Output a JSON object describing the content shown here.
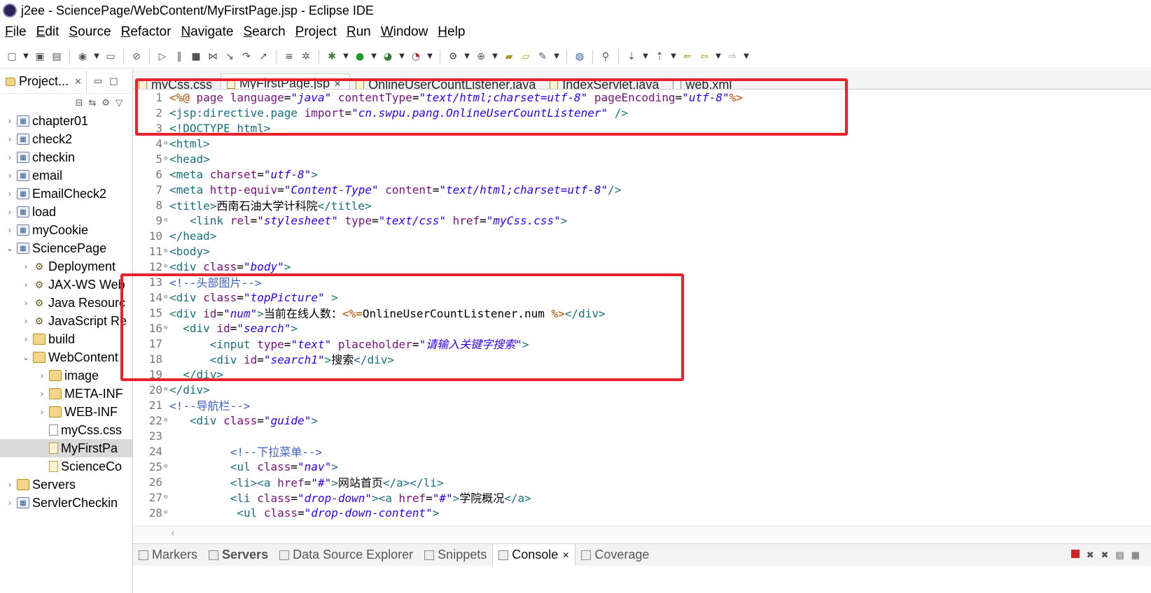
{
  "window": {
    "title": "j2ee - SciencePage/WebContent/MyFirstPage.jsp - Eclipse IDE"
  },
  "menu": [
    "File",
    "Edit",
    "Source",
    "Refactor",
    "Navigate",
    "Search",
    "Project",
    "Run",
    "Window",
    "Help"
  ],
  "project_explorer": {
    "tab_label": "Project...",
    "tree": [
      {
        "label": "chapter01",
        "icon": "project-icon",
        "depth": 0,
        "expanded": false
      },
      {
        "label": "check2",
        "icon": "project-icon",
        "depth": 0,
        "expanded": false
      },
      {
        "label": "checkin",
        "icon": "project-icon",
        "depth": 0,
        "expanded": false
      },
      {
        "label": "email",
        "icon": "project-icon",
        "depth": 0,
        "expanded": false
      },
      {
        "label": "EmailCheck2",
        "icon": "project-icon",
        "depth": 0,
        "expanded": false
      },
      {
        "label": "load",
        "icon": "project-icon",
        "depth": 0,
        "expanded": false
      },
      {
        "label": "myCookie",
        "icon": "project-icon",
        "depth": 0,
        "expanded": false
      },
      {
        "label": "SciencePage",
        "icon": "project-icon",
        "depth": 0,
        "expanded": true
      },
      {
        "label": "Deployment",
        "icon": "deployment-icon",
        "depth": 1,
        "expanded": false
      },
      {
        "label": "JAX-WS Web",
        "icon": "jaxws-icon",
        "depth": 1,
        "expanded": false
      },
      {
        "label": "Java Resourc",
        "icon": "java-resources-icon",
        "depth": 1,
        "expanded": false
      },
      {
        "label": "JavaScript Re",
        "icon": "javascript-resources-icon",
        "depth": 1,
        "expanded": false
      },
      {
        "label": "build",
        "icon": "folder-icon",
        "depth": 1,
        "expanded": false
      },
      {
        "label": "WebContent",
        "icon": "folder-icon",
        "depth": 1,
        "expanded": true
      },
      {
        "label": "image",
        "icon": "folder-icon",
        "depth": 2,
        "expanded": false
      },
      {
        "label": "META-INF",
        "icon": "folder-icon",
        "depth": 2,
        "expanded": false
      },
      {
        "label": "WEB-INF",
        "icon": "folder-icon",
        "depth": 2,
        "expanded": false
      },
      {
        "label": "myCss.css",
        "icon": "file-icon",
        "depth": 2,
        "expanded": null
      },
      {
        "label": "MyFirstPa",
        "icon": "jsp-file-icon",
        "depth": 2,
        "expanded": null,
        "selected": true
      },
      {
        "label": "ScienceCo",
        "icon": "jsp-file-icon",
        "depth": 2,
        "expanded": null
      },
      {
        "label": "Servers",
        "icon": "folder-icon",
        "depth": 0,
        "expanded": false
      },
      {
        "label": "ServlerCheckin",
        "icon": "project-icon",
        "depth": 0,
        "expanded": false
      }
    ]
  },
  "editor_tabs": [
    {
      "label": "myCss.css",
      "active": false,
      "icon": "css-file-icon"
    },
    {
      "label": "MyFirstPage.jsp",
      "active": true,
      "icon": "jsp-file-icon"
    },
    {
      "label": "OnlineUserCountListener.java",
      "active": false,
      "icon": "java-file-icon"
    },
    {
      "label": "IndexServlet.java",
      "active": false,
      "icon": "java-file-icon"
    },
    {
      "label": "web.xml",
      "active": false,
      "icon": "xml-file-icon"
    }
  ],
  "code": [
    {
      "n": "1",
      "fold": "",
      "t": [
        [
          "dir",
          "<%@ "
        ],
        [
          "attr",
          "page "
        ],
        [
          "attr",
          "language"
        ],
        [
          "txt",
          "="
        ],
        [
          "val",
          "\"java\""
        ],
        [
          "txt",
          " "
        ],
        [
          "attr",
          "contentType"
        ],
        [
          "txt",
          "="
        ],
        [
          "val",
          "\"text/html;charset=utf-8\""
        ],
        [
          "txt",
          " "
        ],
        [
          "attr",
          "pageEncoding"
        ],
        [
          "txt",
          "="
        ],
        [
          "val",
          "\"utf-8\""
        ],
        [
          "dir",
          "%>"
        ]
      ]
    },
    {
      "n": "2",
      "fold": "",
      "t": [
        [
          "tag",
          "<jsp:directive.page "
        ],
        [
          "attr",
          "import"
        ],
        [
          "txt",
          "="
        ],
        [
          "val",
          "\"cn.swpu.pang.OnlineUserCountListener\""
        ],
        [
          "tag",
          " />"
        ]
      ]
    },
    {
      "n": "3",
      "fold": "",
      "t": [
        [
          "tag",
          "<!DOCTYPE html>"
        ]
      ]
    },
    {
      "n": "4",
      "fold": "⊖",
      "t": [
        [
          "tag",
          "<html>"
        ]
      ]
    },
    {
      "n": "5",
      "fold": "⊖",
      "t": [
        [
          "tag",
          "<head>"
        ]
      ]
    },
    {
      "n": "6",
      "fold": "",
      "t": [
        [
          "tag",
          "<meta "
        ],
        [
          "attr",
          "charset"
        ],
        [
          "txt",
          "="
        ],
        [
          "val",
          "\"utf-8\""
        ],
        [
          "tag",
          ">"
        ]
      ]
    },
    {
      "n": "7",
      "fold": "",
      "t": [
        [
          "tag",
          "<meta "
        ],
        [
          "attr",
          "http-equiv"
        ],
        [
          "txt",
          "="
        ],
        [
          "val",
          "\"Content-Type\""
        ],
        [
          "txt",
          " "
        ],
        [
          "attr",
          "content"
        ],
        [
          "txt",
          "="
        ],
        [
          "val",
          "\"text/html;charset=utf-8\""
        ],
        [
          "tag",
          "/>"
        ]
      ]
    },
    {
      "n": "8",
      "fold": "",
      "t": [
        [
          "tag",
          "<title>"
        ],
        [
          "txt",
          "西南石油大学计科院"
        ],
        [
          "tag",
          "</title>"
        ]
      ]
    },
    {
      "n": "9",
      "fold": "⊖",
      "t": [
        [
          "txt",
          "   "
        ],
        [
          "tag",
          "<link "
        ],
        [
          "attr",
          "rel"
        ],
        [
          "txt",
          "="
        ],
        [
          "val",
          "\"stylesheet\""
        ],
        [
          "txt",
          " "
        ],
        [
          "attr",
          "type"
        ],
        [
          "txt",
          "="
        ],
        [
          "val",
          "\"text/css\""
        ],
        [
          "txt",
          " "
        ],
        [
          "attr",
          "href"
        ],
        [
          "txt",
          "="
        ],
        [
          "val",
          "\"myCss.css\""
        ],
        [
          "tag",
          ">"
        ]
      ]
    },
    {
      "n": "10",
      "fold": "",
      "t": [
        [
          "tag",
          "</head>"
        ]
      ]
    },
    {
      "n": "11",
      "fold": "⊖",
      "t": [
        [
          "tag",
          "<body>"
        ]
      ]
    },
    {
      "n": "12",
      "fold": "⊖",
      "t": [
        [
          "tag",
          "<div "
        ],
        [
          "attr",
          "class"
        ],
        [
          "txt",
          "="
        ],
        [
          "val",
          "\"body\""
        ],
        [
          "tag",
          ">"
        ]
      ]
    },
    {
      "n": "13",
      "fold": "",
      "t": [
        [
          "cmt",
          "<!--头部图片-->"
        ]
      ]
    },
    {
      "n": "14",
      "fold": "⊖",
      "t": [
        [
          "tag",
          "<div "
        ],
        [
          "attr",
          "class"
        ],
        [
          "txt",
          "="
        ],
        [
          "val",
          "\"topPicture\""
        ],
        [
          "tag",
          " >"
        ]
      ]
    },
    {
      "n": "15",
      "fold": "",
      "t": [
        [
          "tag",
          "<div "
        ],
        [
          "attr",
          "id"
        ],
        [
          "txt",
          "="
        ],
        [
          "val",
          "\"num\""
        ],
        [
          "tag",
          ">"
        ],
        [
          "txt",
          "当前在线人数："
        ],
        [
          "dir",
          "<%="
        ],
        [
          "txt",
          "OnlineUserCountListener.num "
        ],
        [
          "dir",
          "%>"
        ],
        [
          "tag",
          "</div>"
        ]
      ]
    },
    {
      "n": "16",
      "fold": "⊖",
      "t": [
        [
          "txt",
          "  "
        ],
        [
          "tag",
          "<div "
        ],
        [
          "attr",
          "id"
        ],
        [
          "txt",
          "="
        ],
        [
          "val",
          "\"search\""
        ],
        [
          "tag",
          ">"
        ]
      ]
    },
    {
      "n": "17",
      "fold": "",
      "t": [
        [
          "txt",
          "      "
        ],
        [
          "tag",
          "<input "
        ],
        [
          "attr",
          "type"
        ],
        [
          "txt",
          "="
        ],
        [
          "val",
          "\"text\""
        ],
        [
          "txt",
          " "
        ],
        [
          "attr",
          "placeholder"
        ],
        [
          "txt",
          "="
        ],
        [
          "val",
          "\"请输入关键字搜索\""
        ],
        [
          "tag",
          ">"
        ]
      ]
    },
    {
      "n": "18",
      "fold": "",
      "t": [
        [
          "txt",
          "      "
        ],
        [
          "tag",
          "<div "
        ],
        [
          "attr",
          "id"
        ],
        [
          "txt",
          "="
        ],
        [
          "val",
          "\"search1\""
        ],
        [
          "tag",
          ">"
        ],
        [
          "txt",
          "搜索"
        ],
        [
          "tag",
          "</div>"
        ]
      ]
    },
    {
      "n": "19",
      "fold": "",
      "t": [
        [
          "txt",
          "  "
        ],
        [
          "tag",
          "</div>"
        ]
      ]
    },
    {
      "n": "20",
      "fold": "⊖",
      "t": [
        [
          "tag",
          "</div>"
        ]
      ]
    },
    {
      "n": "21",
      "fold": "",
      "t": [
        [
          "cmt",
          "<!--导航栏-->"
        ]
      ]
    },
    {
      "n": "22",
      "fold": "⊖",
      "t": [
        [
          "txt",
          "   "
        ],
        [
          "tag",
          "<div "
        ],
        [
          "attr",
          "class"
        ],
        [
          "txt",
          "="
        ],
        [
          "val",
          "\"guide\""
        ],
        [
          "tag",
          ">"
        ]
      ]
    },
    {
      "n": "23",
      "fold": "",
      "t": []
    },
    {
      "n": "24",
      "fold": "",
      "t": [
        [
          "txt",
          "         "
        ],
        [
          "cmt",
          "<!--下拉菜单-->"
        ]
      ]
    },
    {
      "n": "25",
      "fold": "⊖",
      "t": [
        [
          "txt",
          "         "
        ],
        [
          "tag",
          "<ul "
        ],
        [
          "attr",
          "class"
        ],
        [
          "txt",
          "="
        ],
        [
          "val",
          "\"nav\""
        ],
        [
          "tag",
          ">"
        ]
      ]
    },
    {
      "n": "26",
      "fold": "",
      "t": [
        [
          "txt",
          "         "
        ],
        [
          "tag",
          "<li><a "
        ],
        [
          "attr",
          "href"
        ],
        [
          "txt",
          "="
        ],
        [
          "val",
          "\"#\""
        ],
        [
          "tag",
          ">"
        ],
        [
          "txt",
          "网站首页"
        ],
        [
          "tag",
          "</a></li>"
        ]
      ]
    },
    {
      "n": "27",
      "fold": "⊖",
      "t": [
        [
          "txt",
          "         "
        ],
        [
          "tag",
          "<li "
        ],
        [
          "attr",
          "class"
        ],
        [
          "txt",
          "="
        ],
        [
          "val",
          "\"drop-down\""
        ],
        [
          "tag",
          "><a "
        ],
        [
          "attr",
          "href"
        ],
        [
          "txt",
          "="
        ],
        [
          "val",
          "\"#\""
        ],
        [
          "tag",
          ">"
        ],
        [
          "txt",
          "学院概况"
        ],
        [
          "tag",
          "</a>"
        ]
      ]
    },
    {
      "n": "28",
      "fold": "⊖",
      "t": [
        [
          "txt",
          "          "
        ],
        [
          "tag",
          "<ul "
        ],
        [
          "attr",
          "class"
        ],
        [
          "txt",
          "="
        ],
        [
          "val",
          "\"drop-down-content\""
        ],
        [
          "tag",
          ">"
        ]
      ]
    }
  ],
  "bottom_tabs": [
    {
      "label": "Markers",
      "active": false
    },
    {
      "label": "Servers",
      "active": false
    },
    {
      "label": "Data Source Explorer",
      "active": false
    },
    {
      "label": "Snippets",
      "active": false
    },
    {
      "label": "Console",
      "active": true
    },
    {
      "label": "Coverage",
      "active": false
    }
  ],
  "colors": {
    "highlight_box": "#e8232b",
    "tag": "#17707e",
    "attribute": "#7a0f7f",
    "value": "#2a00ff",
    "comment": "#3f5fbf"
  }
}
